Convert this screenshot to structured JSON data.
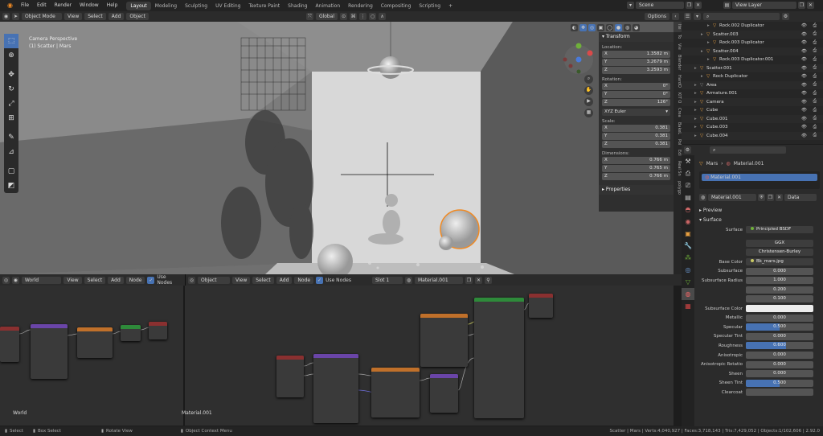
{
  "menu": [
    "File",
    "Edit",
    "Render",
    "Window",
    "Help"
  ],
  "workspaces": [
    "Layout",
    "Modeling",
    "Sculpting",
    "UV Editing",
    "Texture Paint",
    "Shading",
    "Animation",
    "Rendering",
    "Compositing",
    "Scripting"
  ],
  "active_workspace": "Layout",
  "add_tab": "+",
  "scene_name": "Scene",
  "view_layer": "View Layer",
  "viewport": {
    "mode": "Object Mode",
    "menus": [
      "View",
      "Select",
      "Add",
      "Object"
    ],
    "orientation": "Global",
    "options": "Options",
    "overlay_title": "Camera Perspective",
    "overlay_subtitle": "(1) Scatter | Mars"
  },
  "transform_panel": {
    "title": "Transform",
    "location_label": "Location:",
    "location": [
      {
        "axis": "X",
        "value": "1.3582 m"
      },
      {
        "axis": "Y",
        "value": "3.2679 m"
      },
      {
        "axis": "Z",
        "value": "3.2593 m"
      }
    ],
    "rotation_label": "Rotation:",
    "rotation": [
      {
        "axis": "X",
        "value": "0°"
      },
      {
        "axis": "Y",
        "value": "0°"
      },
      {
        "axis": "Z",
        "value": "126°"
      }
    ],
    "rotation_mode": "XYZ Euler",
    "scale_label": "Scale:",
    "scale": [
      {
        "axis": "X",
        "value": "0.381"
      },
      {
        "axis": "Y",
        "value": "0.381"
      },
      {
        "axis": "Z",
        "value": "0.381"
      }
    ],
    "dimensions_label": "Dimensions:",
    "dimensions": [
      {
        "axis": "X",
        "value": "0.766 m"
      },
      {
        "axis": "Y",
        "value": "0.765 m"
      },
      {
        "axis": "Z",
        "value": "0.766 m"
      }
    ],
    "properties": "Properties"
  },
  "n_tabs": [
    "Ite",
    "To",
    "Vie",
    "Blender",
    "HardO",
    "KIT O",
    "Crea",
    "BakeL",
    "Pol",
    "Edi",
    "Real Sn",
    "polygo"
  ],
  "outliner": {
    "items": [
      {
        "name": "Rock.002 Duplicator",
        "indent": 4,
        "color": "#e8a040"
      },
      {
        "name": "Scatter.003",
        "indent": 3,
        "color": "#e8a040"
      },
      {
        "name": "Rock.003 Duplicator",
        "indent": 4,
        "color": "#e8a040"
      },
      {
        "name": "Scatter.004",
        "indent": 3,
        "color": "#e8a040"
      },
      {
        "name": "Rock.003 Duplicator.001",
        "indent": 4,
        "color": "#e8a040"
      },
      {
        "name": "Scatter.001",
        "indent": 2,
        "color": "#e8a040"
      },
      {
        "name": "Rock Duplicator",
        "indent": 3,
        "color": "#e8a040"
      },
      {
        "name": "Area",
        "indent": 2,
        "color": "#888"
      },
      {
        "name": "Armature.001",
        "indent": 2,
        "color": "#e8a040"
      },
      {
        "name": "Camera",
        "indent": 2,
        "color": "#e8a040"
      },
      {
        "name": "Cube",
        "indent": 2,
        "color": "#e8a040"
      },
      {
        "name": "Cube.001",
        "indent": 2,
        "color": "#e8a040"
      },
      {
        "name": "Cube.003",
        "indent": 2,
        "color": "#e8a040"
      },
      {
        "name": "Cube.004",
        "indent": 2,
        "color": "#e8a040"
      }
    ]
  },
  "properties": {
    "object": "Mars",
    "material": "Material.001",
    "slot": "Material.001",
    "data": "Data",
    "preview": "Preview",
    "surface_section": "Surface",
    "surface_label": "Surface",
    "surface_value": "Principled BSDF",
    "distribution": "GGX",
    "subsurface_method": "Christensen-Burley",
    "rows": [
      {
        "label": "Base Color",
        "value": "Bk_mars.jpg",
        "kind": "tex"
      },
      {
        "label": "Subsurface",
        "value": "0.000",
        "kind": "num"
      },
      {
        "label": "Subsurface Radius",
        "value": "1.000",
        "kind": "num"
      },
      {
        "label": "",
        "value": "0.200",
        "kind": "num"
      },
      {
        "label": "",
        "value": "0.100",
        "kind": "num"
      },
      {
        "label": "Subsurface Color",
        "value": "",
        "kind": "color"
      },
      {
        "label": "Metallic",
        "value": "0.000",
        "kind": "num"
      },
      {
        "label": "Specular",
        "value": "0.500",
        "kind": "slider",
        "fill": 0.5
      },
      {
        "label": "Specular Tint",
        "value": "0.000",
        "kind": "num"
      },
      {
        "label": "Roughness",
        "value": "0.600",
        "kind": "slider",
        "fill": 0.6
      },
      {
        "label": "Anisotropic",
        "value": "0.000",
        "kind": "num"
      },
      {
        "label": "Anisotropic Rotatio",
        "value": "0.000",
        "kind": "num"
      },
      {
        "label": "Sheen",
        "value": "0.000",
        "kind": "num"
      },
      {
        "label": "Sheen Tint",
        "value": "0.500",
        "kind": "slider",
        "fill": 0.5
      },
      {
        "label": "Clearcoat",
        "value": "",
        "kind": "num"
      }
    ]
  },
  "node_editor_left": {
    "world": "World",
    "menus": [
      "View",
      "Select",
      "Add",
      "Node"
    ],
    "use_nodes": "Use Nodes",
    "area_label": "World"
  },
  "node_editor_right": {
    "object": "Object",
    "menus": [
      "View",
      "Select",
      "Add",
      "Node"
    ],
    "use_nodes": "Use Nodes",
    "slot": "Slot 1",
    "material": "Material.001",
    "area_label": "Material.001"
  },
  "statusbar": {
    "select": "Select",
    "box_select": "Box Select",
    "rotate_view": "Rotate View",
    "context_menu": "Object Context Menu",
    "stats": "Scatter | Mars | Verts:4,040,927 | Faces:3,718,143 | Tris:7,429,052 | Objects:1/102,606 | 2.92.0"
  },
  "colors": {
    "accent": "#4772b3",
    "orange": "#e8a040",
    "selection": "#f08a24"
  }
}
